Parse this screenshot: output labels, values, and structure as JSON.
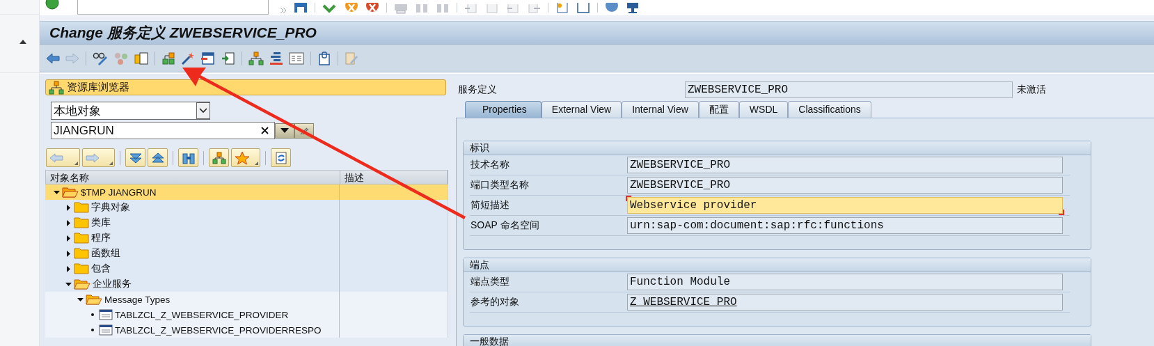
{
  "title": "Change 服务定义 ZWEBSERVICE_PRO",
  "browser": {
    "title": "资源库浏览器",
    "object_type": "本地对象",
    "object_name": "JIANGRUN",
    "columns": [
      "对象名称",
      "描述"
    ],
    "tree": [
      {
        "label": "$TMP JIANGRUN",
        "kind": "package",
        "expanded": true,
        "selected": true,
        "children": [
          {
            "label": "字典对象",
            "kind": "folder",
            "expanded": false,
            "selected": false
          },
          {
            "label": "类库",
            "kind": "folder",
            "expanded": false,
            "selected": false
          },
          {
            "label": "程序",
            "kind": "folder",
            "expanded": false,
            "selected": false
          },
          {
            "label": "函数组",
            "kind": "folder",
            "expanded": false,
            "selected": false
          },
          {
            "label": "包含",
            "kind": "folder",
            "expanded": false,
            "selected": false
          },
          {
            "label": "企业服务",
            "kind": "folder",
            "expanded": true,
            "selected": false,
            "children": [
              {
                "label": "Message Types",
                "kind": "folder",
                "expanded": true,
                "selected": false,
                "children": [
                  {
                    "label": "TABLZCL_Z_WEBSERVICE_PROVIDER",
                    "kind": "object",
                    "selected": false
                  },
                  {
                    "label": "TABLZCL_Z_WEBSERVICE_PROVIDERRESPO",
                    "kind": "object",
                    "selected": false
                  }
                ]
              }
            ]
          }
        ]
      }
    ]
  },
  "definition": {
    "label": "服务定义",
    "value": "ZWEBSERVICE_PRO",
    "status": "未激活"
  },
  "tabs": [
    {
      "label": "Properties",
      "selected": true
    },
    {
      "label": "External View",
      "selected": false
    },
    {
      "label": "Internal View",
      "selected": false
    },
    {
      "label": "配置",
      "selected": false
    },
    {
      "label": "WSDL",
      "selected": false
    },
    {
      "label": "Classifications",
      "selected": false
    }
  ],
  "groups": [
    {
      "title": "标识",
      "fields": [
        {
          "label": "技术名称",
          "value": "ZWEBSERVICE_PRO",
          "kind": "text",
          "focused": false
        },
        {
          "label": "端口类型名称",
          "value": "ZWEBSERVICE_PRO",
          "kind": "text",
          "focused": false
        },
        {
          "label": "简短描述",
          "value": "Webservice provider",
          "kind": "text",
          "focused": true
        },
        {
          "label": "SOAP 命名空间",
          "value": "urn:sap-com:document:sap:rfc:functions",
          "kind": "text",
          "focused": false
        }
      ]
    },
    {
      "title": "端点",
      "fields": [
        {
          "label": "端点类型",
          "value": "Function Module",
          "kind": "text",
          "focused": false
        },
        {
          "label": "参考的对象",
          "value": "Z_WEBSERVICE_PRO",
          "kind": "link",
          "focused": false
        }
      ]
    },
    {
      "title": "一般数据"
    }
  ]
}
